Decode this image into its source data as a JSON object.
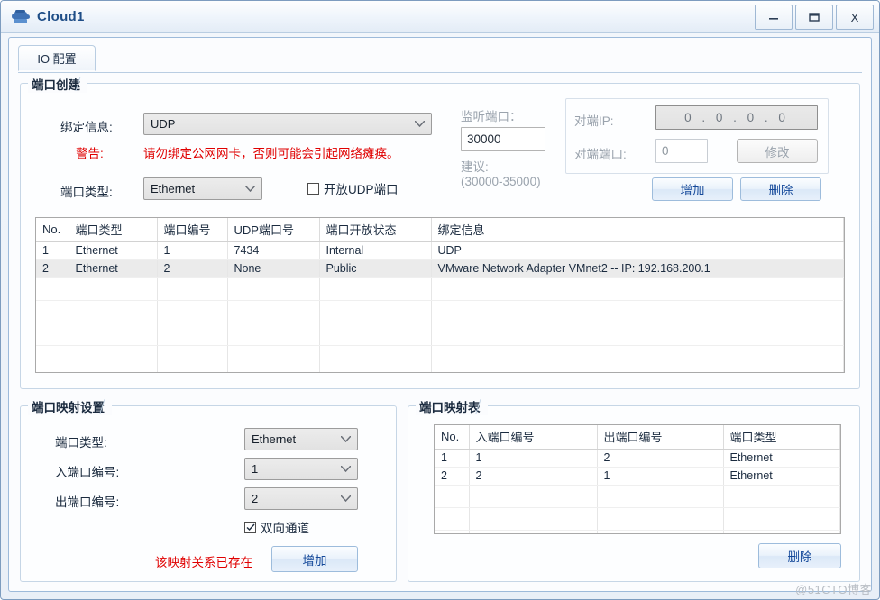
{
  "window": {
    "title": "Cloud1",
    "icon": "cloud-icon",
    "minimize_label": "—",
    "maximize_label": "▢",
    "close_label": "X"
  },
  "tabs": [
    {
      "label": "IO 配置",
      "selected": true
    }
  ],
  "port_create": {
    "group_title": "端口创建",
    "binding_label": "绑定信息:",
    "binding_value": "UDP",
    "warning_label": "警告:",
    "warning_text": "请勿绑定公网网卡，否则可能会引起网络瘫痪。",
    "port_type_label": "端口类型:",
    "port_type_value": "Ethernet",
    "open_udp_label": "开放UDP端口",
    "open_udp_checked": false,
    "listen_port_label": "监听端口：",
    "listen_port_value": "30000",
    "suggest_label": "建议:",
    "suggest_range": "(30000-35000)",
    "peer_ip_label": "对端IP:",
    "peer_ip_value": "0  .  0  .  0  .  0",
    "peer_port_label": "对端端口:",
    "peer_port_value": "0",
    "modify_label": "修改",
    "add_label": "增加",
    "delete_label": "删除"
  },
  "port_table": {
    "columns": [
      "No.",
      "端口类型",
      "端口编号",
      "UDP端口号",
      "端口开放状态",
      "绑定信息"
    ],
    "rows": [
      {
        "cells": [
          "1",
          "Ethernet",
          "1",
          "7434",
          "Internal",
          "UDP"
        ],
        "selected": false
      },
      {
        "cells": [
          "2",
          "Ethernet",
          "2",
          "None",
          "Public",
          "VMware Network Adapter VMnet2 -- IP: 192.168.200.1"
        ],
        "selected": true
      }
    ],
    "empty_rows": 6
  },
  "mapping_settings": {
    "group_title": "端口映射设置",
    "port_type_label": "端口类型:",
    "port_type_value": "Ethernet",
    "in_port_label": "入端口编号:",
    "in_port_value": "1",
    "out_port_label": "出端口编号:",
    "out_port_value": "2",
    "bidirectional_label": "双向通道",
    "bidirectional_checked": true,
    "error_text": "该映射关系已存在",
    "add_label": "增加"
  },
  "mapping_table": {
    "group_title": "端口映射表",
    "columns": [
      "No.",
      "入端口编号",
      "出端口编号",
      "端口类型"
    ],
    "rows": [
      {
        "cells": [
          "1",
          "1",
          "2",
          "Ethernet"
        ]
      },
      {
        "cells": [
          "2",
          "2",
          "1",
          "Ethernet"
        ]
      }
    ],
    "empty_rows": 3,
    "delete_label": "删除"
  },
  "watermark": "@51CTO博客",
  "colors": {
    "title_text": "#1f4e87",
    "warning": "#e00000",
    "button_text": "#15499a",
    "disabled_text": "#9aa3ad"
  }
}
